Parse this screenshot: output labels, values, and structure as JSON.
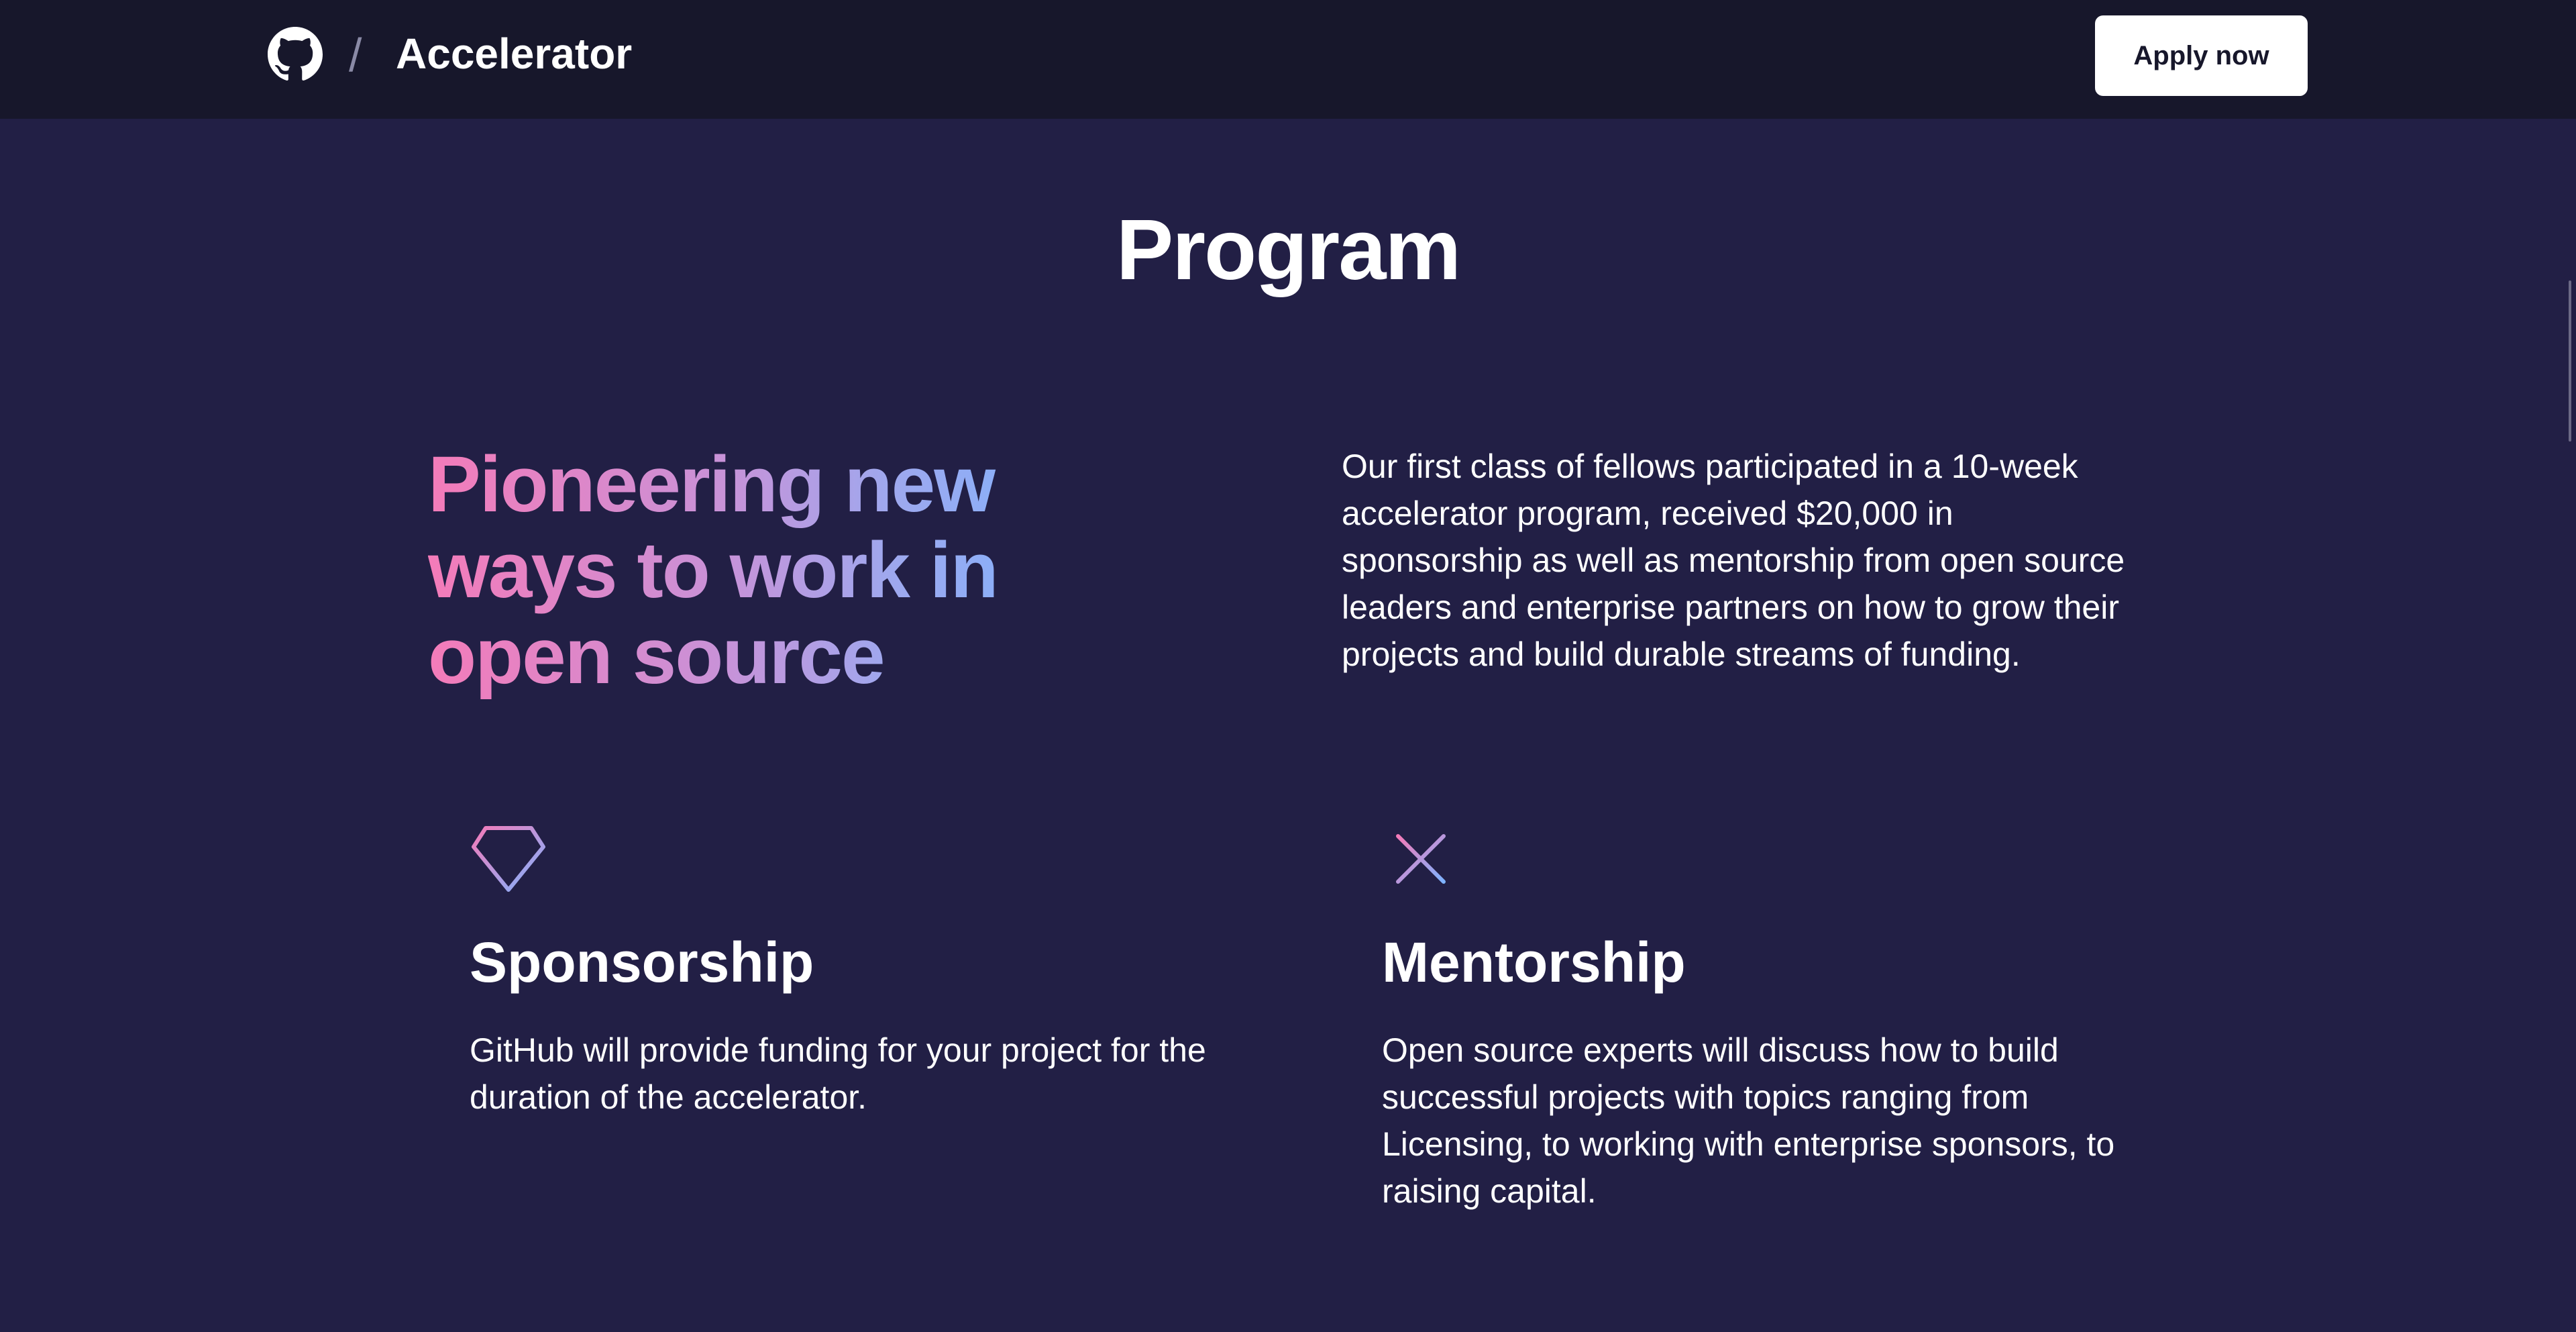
{
  "header": {
    "brand_title": "Accelerator",
    "separator": "/",
    "apply_label": "Apply now"
  },
  "program": {
    "section_title": "Program",
    "hero_heading": "Pioneering new ways to work in open source",
    "intro": "Our first class of fellows participated in a 10-week accelerator program, received $20,000 in sponsorship as well as mentorship from open source leaders and enterprise partners on how to grow their projects and build durable streams of funding.",
    "features": [
      {
        "icon": "diamond-icon",
        "title": "Sponsorship",
        "description": "GitHub will provide funding for your project for the duration of the accelerator."
      },
      {
        "icon": "sparkle-icon",
        "title": "Mentorship",
        "description": "Open source experts will discuss how to build successful projects with topics ranging from Licensing, to working with enterprise sponsors, to raising capital."
      }
    ]
  },
  "colors": {
    "page_background": "#221f45",
    "header_background": "#17172b",
    "gradient_pink": "#f47bb9",
    "gradient_blue": "#7eb3ff"
  }
}
